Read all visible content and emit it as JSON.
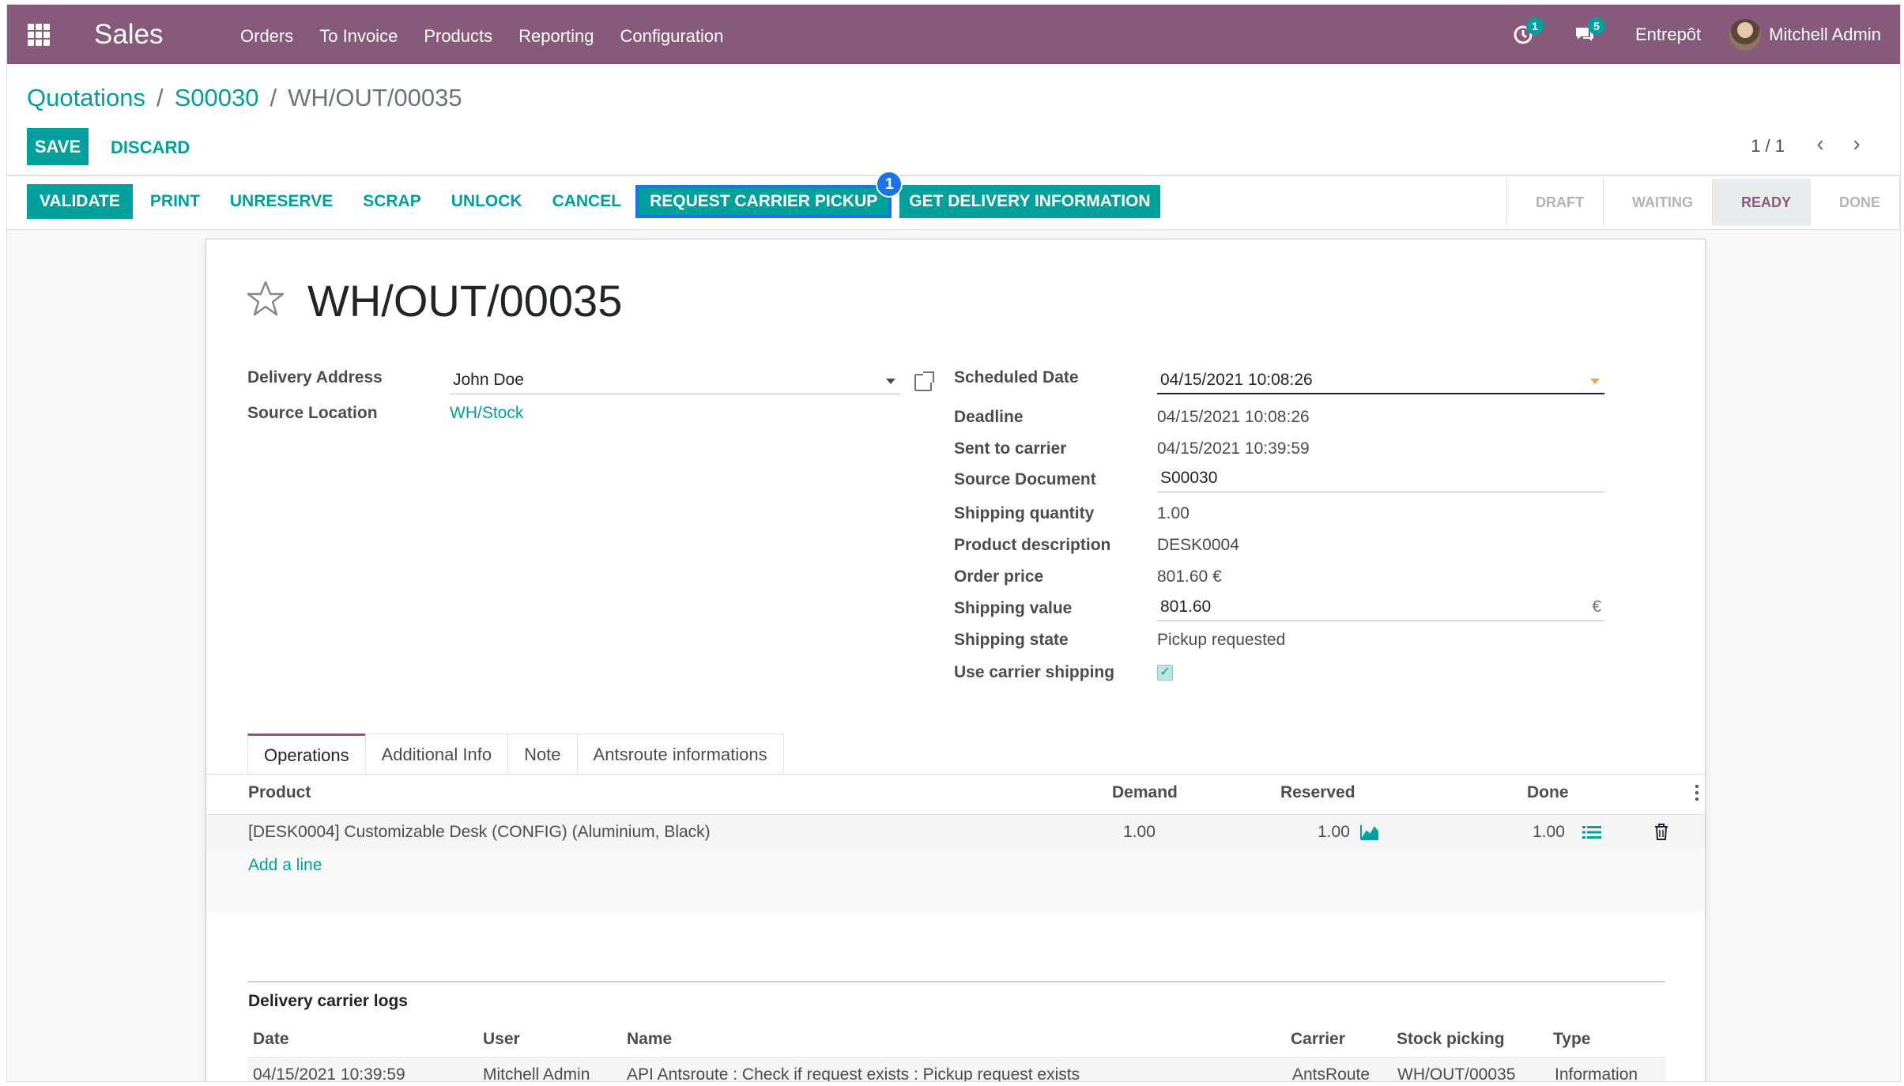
{
  "nav": {
    "app_name": "Sales",
    "menu": [
      "Orders",
      "To Invoice",
      "Products",
      "Reporting",
      "Configuration"
    ],
    "activity_count": "1",
    "message_count": "5",
    "company": "Entrepôt",
    "user": "Mitchell Admin",
    "accent_color": "#875a7b"
  },
  "breadcrumb": {
    "root": "Quotations",
    "order": "S00030",
    "current": "WH/OUT/00035",
    "sep": "/"
  },
  "control": {
    "save": "SAVE",
    "discard": "DISCARD",
    "pager": "1 / 1",
    "prev_icon": "‹",
    "next_icon": "›"
  },
  "actions": {
    "validate": "VALIDATE",
    "print": "PRINT",
    "unreserve": "UNRESERVE",
    "scrap": "SCRAP",
    "unlock": "UNLOCK",
    "cancel": "CANCEL",
    "request_pickup": "REQUEST CARRIER PICKUP",
    "request_pickup_marker": "1",
    "get_delivery": "GET DELIVERY INFORMATION"
  },
  "stages": [
    "DRAFT",
    "WAITING",
    "READY",
    "DONE"
  ],
  "record": {
    "title": "WH/OUT/00035",
    "left_fields": {
      "delivery_address_label": "Delivery Address",
      "delivery_address": "John Doe",
      "source_location_label": "Source Location",
      "source_location": "WH/Stock"
    },
    "right_fields": [
      {
        "label": "Scheduled Date",
        "value": "04/15/2021 10:08:26"
      },
      {
        "label": "Deadline",
        "value": "04/15/2021 10:08:26"
      },
      {
        "label": "Sent to carrier",
        "value": "04/15/2021 10:39:59"
      },
      {
        "label": "Source Document",
        "value": "S00030"
      },
      {
        "label": "Shipping quantity",
        "value": "1.00"
      },
      {
        "label": "Product description",
        "value": "DESK0004"
      },
      {
        "label": "Order price",
        "value": "801.60 €"
      },
      {
        "label": "Shipping value",
        "value": "801.60"
      },
      {
        "label": "Shipping state",
        "value": "Pickup requested"
      },
      {
        "label": "Use carrier shipping",
        "value": "✓"
      }
    ],
    "currency_symbol": "€"
  },
  "tabs": [
    "Operations",
    "Additional Info",
    "Note",
    "Antsroute informations"
  ],
  "operations": {
    "headers": {
      "product": "Product",
      "demand": "Demand",
      "reserved": "Reserved",
      "done": "Done"
    },
    "rows": [
      {
        "product": "[DESK0004] Customizable Desk (CONFIG) (Aluminium, Black)",
        "demand": "1.00",
        "reserved": "1.00",
        "done": "1.00"
      }
    ],
    "add_line": "Add a line"
  },
  "logs": {
    "title": "Delivery carrier logs",
    "headers": {
      "date": "Date",
      "user": "User",
      "name": "Name",
      "carrier": "Carrier",
      "picking": "Stock picking",
      "type": "Type"
    },
    "rows": [
      {
        "date": "04/15/2021 10:39:59",
        "user": "Mitchell Admin",
        "name": "API Antsroute : Check if request exists : Pickup request exists",
        "carrier": "AntsRoute",
        "picking": "WH/OUT/00035",
        "type": "Information"
      }
    ]
  }
}
